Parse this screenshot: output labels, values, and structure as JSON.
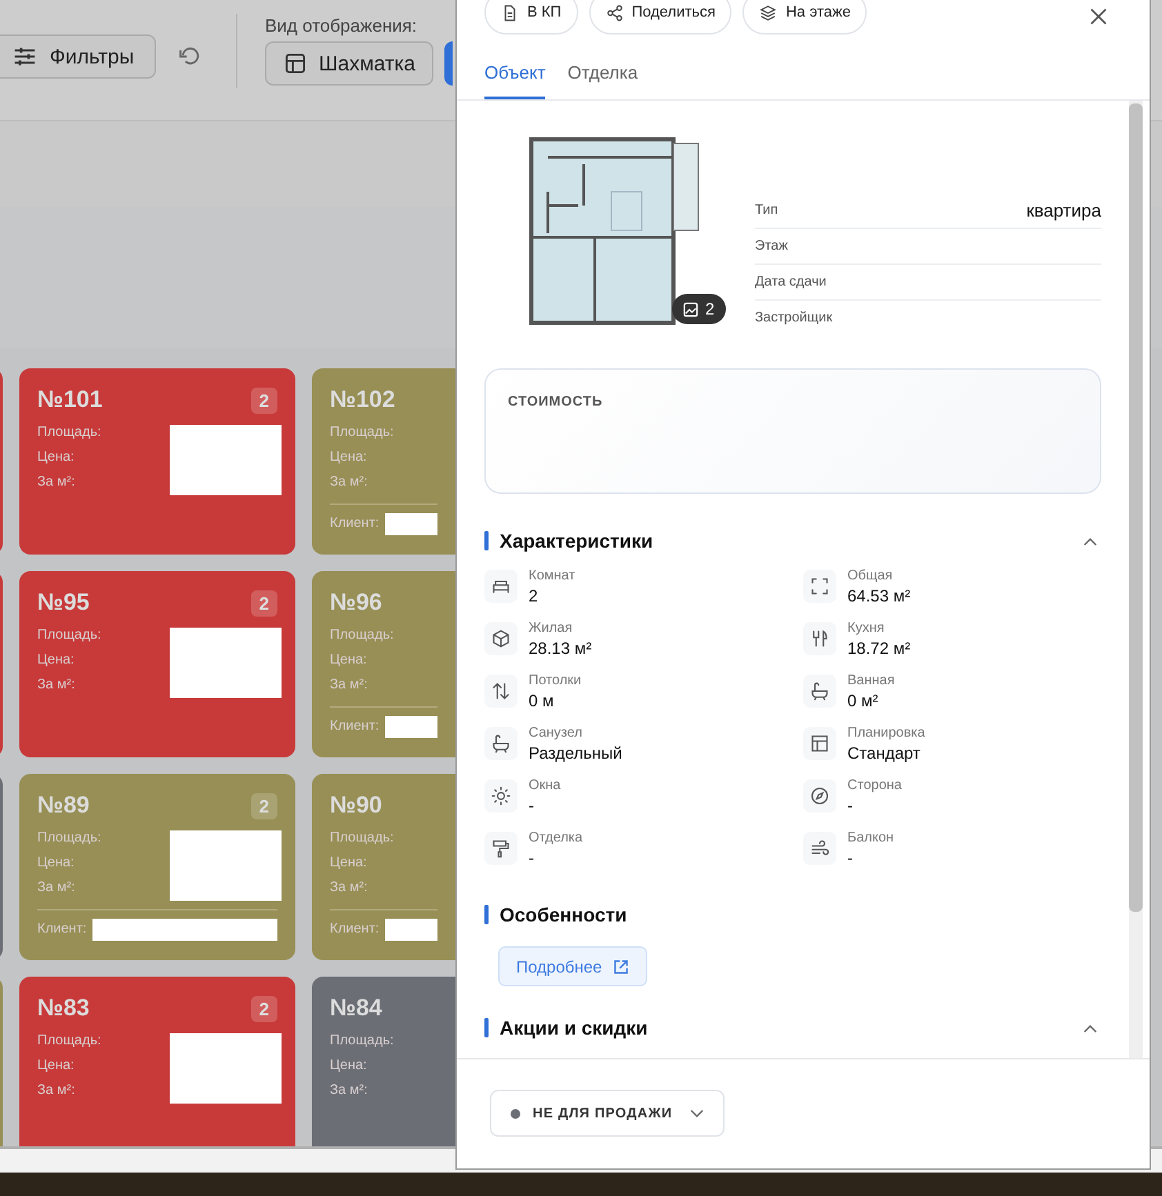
{
  "toolbar": {
    "filters_button": "Фильтры",
    "view_label": "Вид отображения:",
    "view_buttons": [
      {
        "label": "Шахматка",
        "selected": false
      },
      {
        "selected": true
      }
    ]
  },
  "grid": [
    {
      "cards": [
        {
          "color": "#c83a3a"
        },
        {
          "number": "№101",
          "rooms": "2",
          "color": "#c83a3a",
          "labels": [
            "Площадь:",
            "Цена:",
            "За м²:"
          ],
          "values_hidden": true
        },
        {
          "number": "№102",
          "color": "#978f55",
          "labels": [
            "Площадь:",
            "Цена:",
            "За м²:"
          ],
          "client_label": "Клиент:"
        }
      ]
    },
    {
      "cards": [
        {
          "color": "#c83a3a"
        },
        {
          "number": "№95",
          "rooms": "2",
          "color": "#c83a3a",
          "labels": [
            "Площадь:",
            "Цена:",
            "За м²:"
          ],
          "values_hidden": true
        },
        {
          "number": "№96",
          "color": "#978f55",
          "labels": [
            "Площадь:",
            "Цена:",
            "За м²:"
          ],
          "client_label": "Клиент:"
        }
      ]
    },
    {
      "cards": [
        {
          "color": "#6b6e75"
        },
        {
          "number": "№89",
          "rooms": "2",
          "color": "#978f55",
          "labels": [
            "Площадь:",
            "Цена:",
            "За м²:"
          ],
          "values_hidden": true,
          "client_label": "Клиент:"
        },
        {
          "number": "№90",
          "color": "#978f55",
          "labels": [
            "Площадь:",
            "Цена:",
            "За м²:"
          ],
          "client_label": "Клиент:"
        }
      ]
    },
    {
      "cards": [
        {
          "color": "#978f55"
        },
        {
          "number": "№83",
          "rooms": "2",
          "color": "#c83a3a",
          "labels": [
            "Площадь:",
            "Цена:",
            "За м²:"
          ],
          "values_hidden": true
        },
        {
          "number": "№84",
          "color": "#6b6e75",
          "labels": [
            "Площадь:",
            "Цена:",
            "За м²:"
          ]
        }
      ]
    }
  ],
  "panel": {
    "actions": [
      {
        "label": "В КП"
      },
      {
        "label": "Поделиться"
      },
      {
        "label": "На этаже"
      }
    ],
    "tabs": [
      {
        "label": "Объект",
        "selected": true
      },
      {
        "label": "Отделка",
        "selected": false
      }
    ],
    "plan": {
      "photo_count": "2"
    },
    "info": [
      {
        "label": "Тип",
        "value": "квартира"
      },
      {
        "label": "Этаж"
      },
      {
        "label": "Дата сдачи"
      },
      {
        "label": "Застройщик"
      }
    ],
    "price": {
      "label": "СТОИМОСТЬ"
    },
    "sections": [
      {
        "title": "Характеристики",
        "kind": "specs",
        "expanded": true,
        "items": [
          {
            "label": "Комнат",
            "value": "2"
          },
          {
            "label": "Общая",
            "value": "64.53 м²"
          },
          {
            "label": "Жилая",
            "value": "28.13 м²"
          },
          {
            "label": "Кухня",
            "value": "18.72 м²"
          },
          {
            "label": "Потолки",
            "value": "0 м"
          },
          {
            "label": "Ванная",
            "value": "0 м²"
          },
          {
            "label": "Санузел",
            "value": "Раздельный"
          },
          {
            "label": "Планировка",
            "value": "Стандарт"
          },
          {
            "label": "Окна",
            "value": "-"
          },
          {
            "label": "Сторона",
            "value": "-"
          },
          {
            "label": "Отделка",
            "value": "-"
          },
          {
            "label": "Балкон",
            "value": "-"
          }
        ]
      },
      {
        "title": "Особенности",
        "kind": "link",
        "button": "Подробнее"
      },
      {
        "title": "Акции и скидки",
        "kind": "collapsible",
        "expanded": true
      }
    ],
    "status": {
      "label": "НЕ ДЛЯ ПРОДАЖИ",
      "color": "#6b6e75"
    }
  }
}
